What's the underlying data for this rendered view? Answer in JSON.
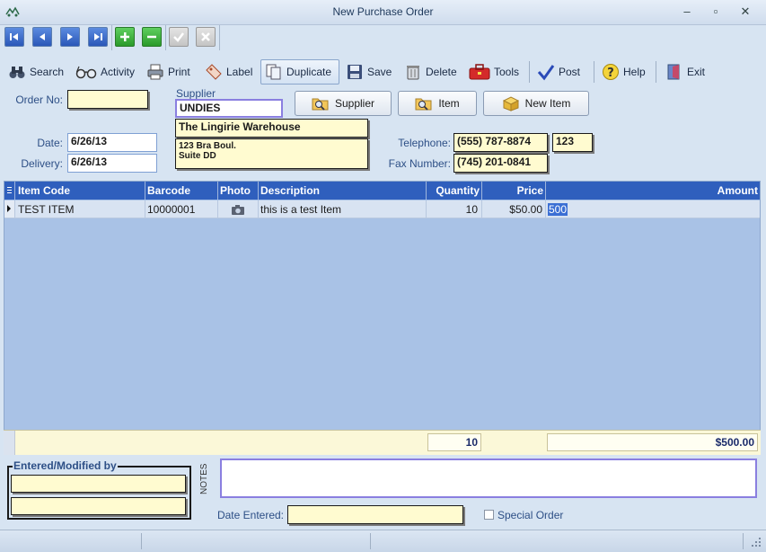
{
  "window": {
    "title": "New Purchase Order"
  },
  "toolbar": {
    "search": "Search",
    "activity": "Activity",
    "print": "Print",
    "label": "Label",
    "duplicate": "Duplicate",
    "save": "Save",
    "delete": "Delete",
    "tools": "Tools",
    "post": "Post",
    "help": "Help",
    "exit": "Exit"
  },
  "form": {
    "order_no_label": "Order No:",
    "order_no_value": "",
    "supplier_label": "Supplier",
    "supplier_code": "UNDIES",
    "supplier_name": "The Lingirie Warehouse",
    "supplier_address_1": "123 Bra Boul.",
    "supplier_address_2": "Suite DD",
    "supplier_button": "Supplier",
    "item_button": "Item",
    "new_item_button": "New Item",
    "date_label": "Date:",
    "date_value": "6/26/13",
    "delivery_label": "Delivery:",
    "delivery_value": "6/26/13",
    "telephone_label": "Telephone:",
    "telephone_value": "(555) 787-8874",
    "telephone_ext": "123",
    "fax_label": "Fax Number:",
    "fax_value": "(745) 201-0841"
  },
  "grid": {
    "columns": [
      "Item Code",
      "Barcode",
      "Photo",
      "Description",
      "Quantity",
      "Price",
      "Amount"
    ],
    "rows": [
      {
        "item_code": "TEST ITEM",
        "barcode": "10000001",
        "description": "this is a test Item",
        "quantity": "10",
        "price": "$50.00",
        "amount": "500"
      }
    ],
    "total_quantity": "10",
    "total_amount": "$500.00"
  },
  "footer": {
    "entered_modified_label": "Entered/Modified by",
    "notes_label": "NOTES",
    "date_entered_label": "Date Entered:",
    "special_order_label": "Special Order"
  }
}
